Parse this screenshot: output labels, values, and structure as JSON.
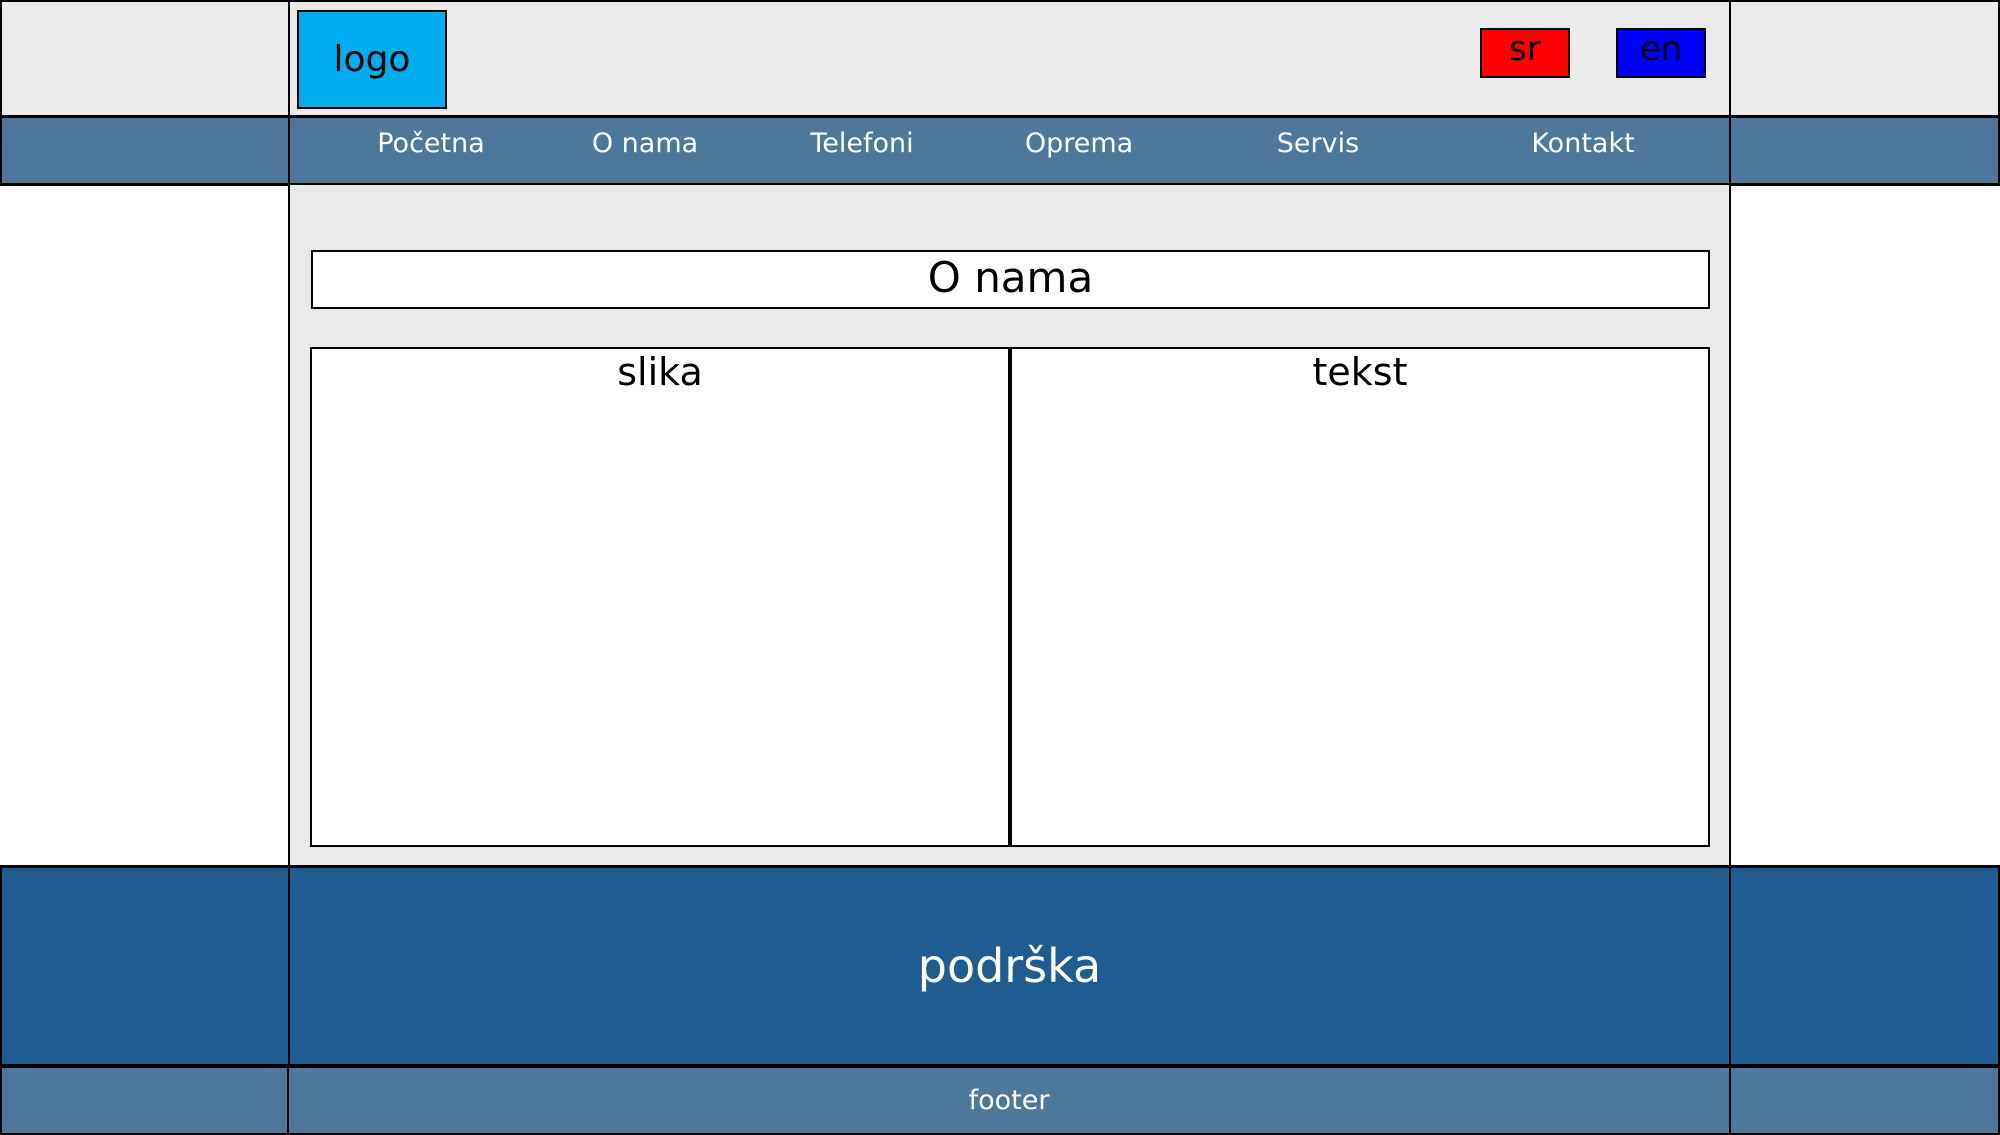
{
  "header": {
    "logo": "logo",
    "languages": [
      {
        "label": "sr",
        "color": "#ff0000"
      },
      {
        "label": "en",
        "color": "#0000ff"
      }
    ]
  },
  "nav": {
    "items": [
      "Početna",
      "O nama",
      "Telefoni",
      "Oprema",
      "Servis",
      "Kontakt"
    ]
  },
  "main": {
    "title": "O nama",
    "columns": [
      "slika",
      "tekst"
    ]
  },
  "support": {
    "label": "podrška"
  },
  "footer": {
    "label": "footer"
  },
  "colors": {
    "nav": "#4e779c",
    "support": "#1f5c91",
    "logo": "#00adef",
    "background": "#eaeaea"
  }
}
